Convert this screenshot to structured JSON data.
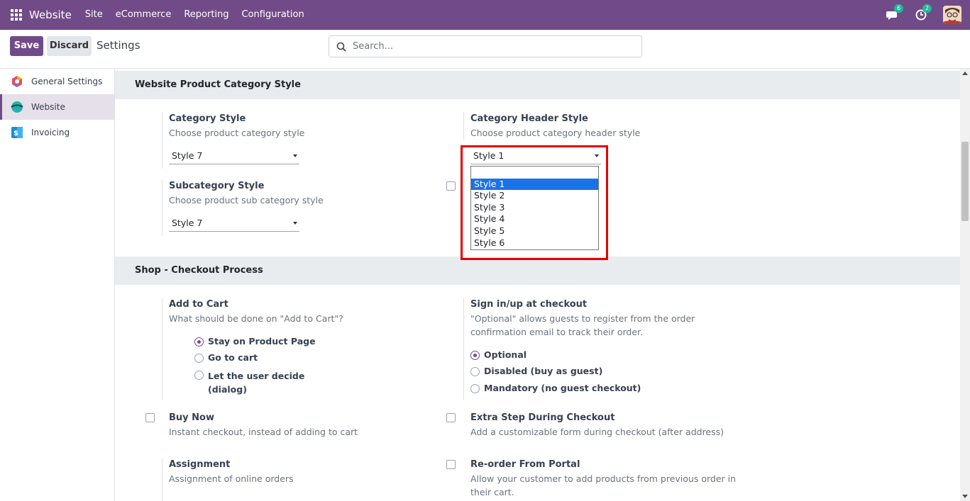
{
  "navbar": {
    "brand": "Website",
    "menu": [
      "Site",
      "eCommerce",
      "Reporting",
      "Configuration"
    ],
    "chat_badge": "6",
    "activity_badge": "2"
  },
  "control": {
    "save_label": "Save",
    "discard_label": "Discard",
    "breadcrumb": "Settings",
    "search_placeholder": "Search..."
  },
  "sidebar": {
    "items": [
      {
        "label": "General Settings",
        "icon": "odoo-settings-icon"
      },
      {
        "label": "Website",
        "icon": "website-icon"
      },
      {
        "label": "Invoicing",
        "icon": "invoicing-icon"
      }
    ]
  },
  "category_section": {
    "title": "Website Product Category Style",
    "category_style": {
      "title": "Category Style",
      "desc": "Choose product category style",
      "value": "Style 7"
    },
    "category_header_style": {
      "title": "Category Header Style",
      "desc": "Choose product category header style",
      "value": "Style 1"
    },
    "subcategory_style": {
      "title": "Subcategory Style",
      "desc": "Choose product sub category style",
      "value": "Style 7"
    },
    "dropdown_options": [
      "",
      "Style 1",
      "Style 2",
      "Style 3",
      "Style 4",
      "Style 5",
      "Style 6"
    ],
    "dropdown_selected": "Style 1"
  },
  "checkout_section": {
    "title": "Shop - Checkout Process",
    "add_to_cart": {
      "title": "Add to Cart",
      "desc": "What should be done on \"Add to Cart\"?",
      "options": [
        "Stay on Product Page",
        "Go to cart",
        "Let the user decide",
        "(dialog)"
      ],
      "selected": "Stay on Product Page"
    },
    "sign_in": {
      "title": "Sign in/up at checkout",
      "desc1": "\"Optional\" allows guests to register from the order",
      "desc2": "confirmation email to track their order.",
      "options": [
        "Optional",
        "Disabled (buy as guest)",
        "Mandatory (no guest checkout)"
      ],
      "selected": "Optional"
    },
    "buy_now": {
      "title": "Buy Now",
      "desc": "Instant checkout, instead of adding to cart"
    },
    "extra_step": {
      "title": "Extra Step During Checkout",
      "desc": "Add a customizable form during checkout (after address)"
    },
    "assignment": {
      "title": "Assignment",
      "desc": "Assignment of online orders"
    },
    "reorder": {
      "title": "Re-order From Portal",
      "desc1": "Allow your customer to add products from previous order in",
      "desc2": "their cart."
    }
  },
  "colors": {
    "brand": "#714b87",
    "highlight": "#e60000",
    "option_selected": "#1a73e8"
  }
}
